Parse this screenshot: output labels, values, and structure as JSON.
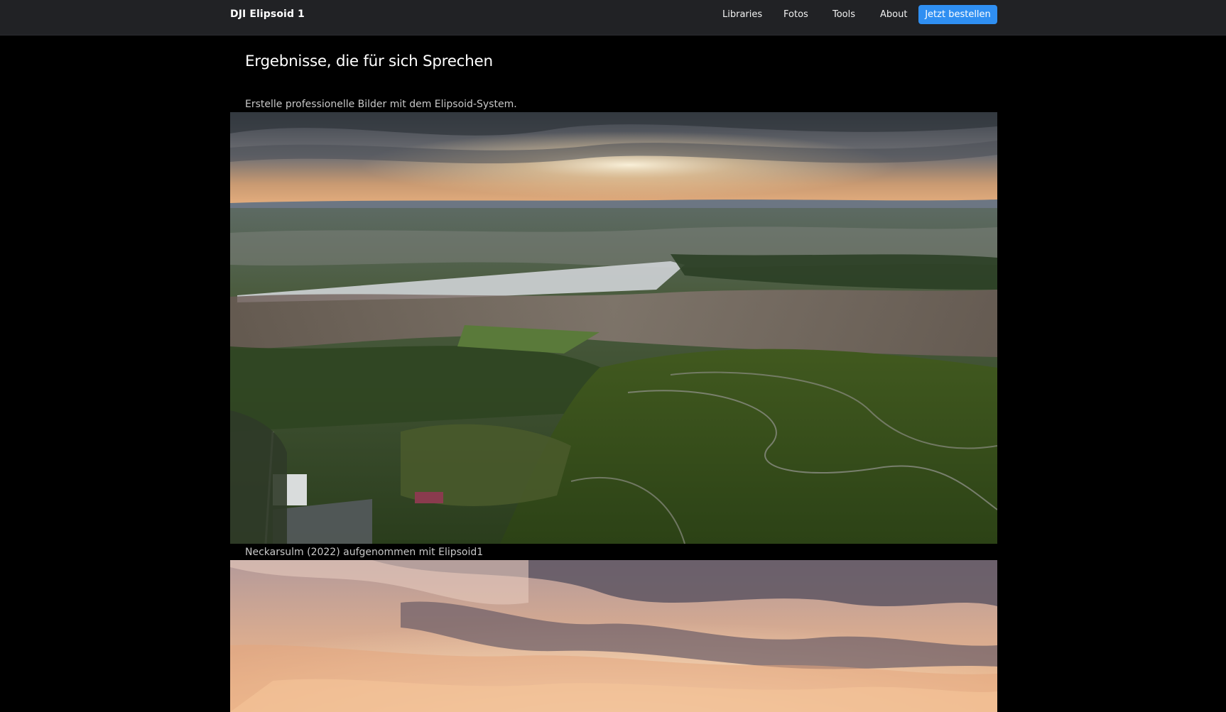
{
  "navbar": {
    "brand": "DJI Elipsoid 1",
    "links": [
      "Libraries",
      "Fotos",
      "Tools",
      "About"
    ],
    "cta_label": "Jetzt bestellen",
    "cta_color": "#2f8ff2",
    "background": "#212225"
  },
  "main": {
    "headline": "Ergebnisse, die für sich Sprechen",
    "intro": "Erstelle professionelle Bilder mit dem Elipsoid-System.",
    "gallery": [
      {
        "caption": "Neckarsulm (2022) aufgenommen mit Elipsoid1"
      },
      {
        "caption": ""
      }
    ]
  }
}
